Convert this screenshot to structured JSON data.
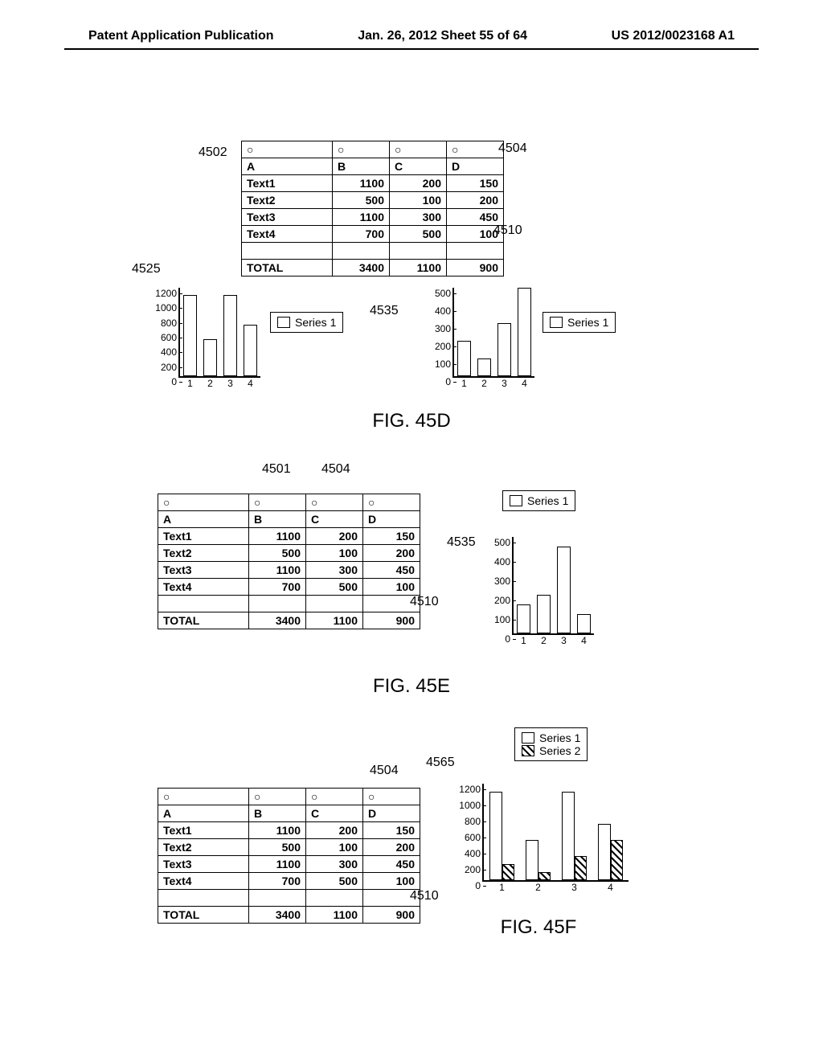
{
  "header": {
    "left": "Patent Application Publication",
    "center": "Jan. 26, 2012  Sheet 55 of 64",
    "right": "US 2012/0023168 A1"
  },
  "refs": {
    "r4502": "4502",
    "r4504_a": "4504",
    "r4510_a": "4510",
    "r4525": "4525",
    "r4535_a": "4535",
    "r4501": "4501",
    "r4504_b": "4504",
    "r4510_b": "4510",
    "r4535_b": "4535",
    "r4504_c": "4504",
    "r4510_c": "4510",
    "r4565": "4565"
  },
  "table": {
    "circ_row": [
      "○",
      "○",
      "○",
      "○"
    ],
    "header_row": [
      "A",
      "B",
      "C",
      "D"
    ],
    "rows": [
      {
        "label": "Text1",
        "b": 1100,
        "c": 200,
        "d": 150
      },
      {
        "label": "Text2",
        "b": 500,
        "c": 100,
        "d": 200
      },
      {
        "label": "Text3",
        "b": 1100,
        "c": 300,
        "d": 450
      },
      {
        "label": "Text4",
        "b": 700,
        "c": 500,
        "d": 100
      }
    ],
    "total_label": "TOTAL",
    "totals": {
      "b": 3400,
      "c": 1100,
      "d": 900
    }
  },
  "legend": {
    "s1": "Series 1",
    "s2": "Series 2"
  },
  "figcaps": {
    "d": "FIG. 45D",
    "e": "FIG. 45E",
    "f": "FIG. 45F"
  },
  "chart_data": [
    {
      "id": "45D-left",
      "ref": "4525",
      "type": "bar",
      "categories": [
        "1",
        "2",
        "3",
        "4"
      ],
      "series": [
        {
          "name": "Series 1",
          "values": [
            1100,
            500,
            1100,
            700
          ]
        }
      ],
      "ylim": [
        0,
        1200
      ],
      "yticks": [
        0,
        200,
        400,
        600,
        800,
        1000,
        1200
      ]
    },
    {
      "id": "45D-right",
      "ref": "4535",
      "type": "bar",
      "categories": [
        "1",
        "2",
        "3",
        "4"
      ],
      "series": [
        {
          "name": "Series 1",
          "values": [
            200,
            100,
            300,
            500
          ]
        }
      ],
      "ylim": [
        0,
        500
      ],
      "yticks": [
        0,
        100,
        200,
        300,
        400,
        500
      ]
    },
    {
      "id": "45E-right",
      "ref": "4535",
      "type": "bar",
      "categories": [
        "1",
        "2",
        "3",
        "4"
      ],
      "series": [
        {
          "name": "Series 1",
          "values": [
            150,
            200,
            450,
            100
          ]
        }
      ],
      "ylim": [
        0,
        500
      ],
      "yticks": [
        0,
        100,
        200,
        300,
        400,
        500
      ]
    },
    {
      "id": "45F-right",
      "ref": "4565",
      "type": "bar",
      "categories": [
        "1",
        "2",
        "3",
        "4"
      ],
      "series": [
        {
          "name": "Series 1",
          "values": [
            1100,
            500,
            1100,
            700
          ]
        },
        {
          "name": "Series 2",
          "values": [
            200,
            100,
            300,
            500
          ]
        }
      ],
      "ylim": [
        0,
        1200
      ],
      "yticks": [
        0,
        200,
        400,
        600,
        800,
        1000,
        1200
      ]
    }
  ]
}
